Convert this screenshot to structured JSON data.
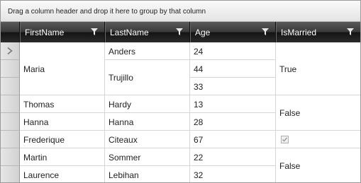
{
  "group_panel": {
    "hint": "Drag a column header and drop it here to group by that column"
  },
  "columns": [
    "FirstName",
    "LastName",
    "Age",
    "IsMarried"
  ],
  "rows": [
    {
      "first": "Maria",
      "last": "Anders",
      "age": "24",
      "married": "True"
    },
    {
      "first": "",
      "last": "Trujillo",
      "age": "44",
      "married": ""
    },
    {
      "first": "",
      "last": "",
      "age": "33",
      "married": ""
    },
    {
      "first": "Thomas",
      "last": "Hardy",
      "age": "13",
      "married": "False"
    },
    {
      "first": "Hanna",
      "last": "Hanna",
      "age": "28",
      "married": ""
    },
    {
      "first": "Frederique",
      "last": "Citeaux",
      "age": "67",
      "married": "checkbox-checked"
    },
    {
      "first": "Martin",
      "last": "Sommer",
      "age": "22",
      "married": "False"
    },
    {
      "first": "Laurence",
      "last": "Lebihan",
      "age": "32",
      "married": ""
    }
  ],
  "icons": {
    "filter": "filter-icon",
    "current_row": "current-row-arrow-icon",
    "checkbox": "checkbox-checked-disabled"
  }
}
